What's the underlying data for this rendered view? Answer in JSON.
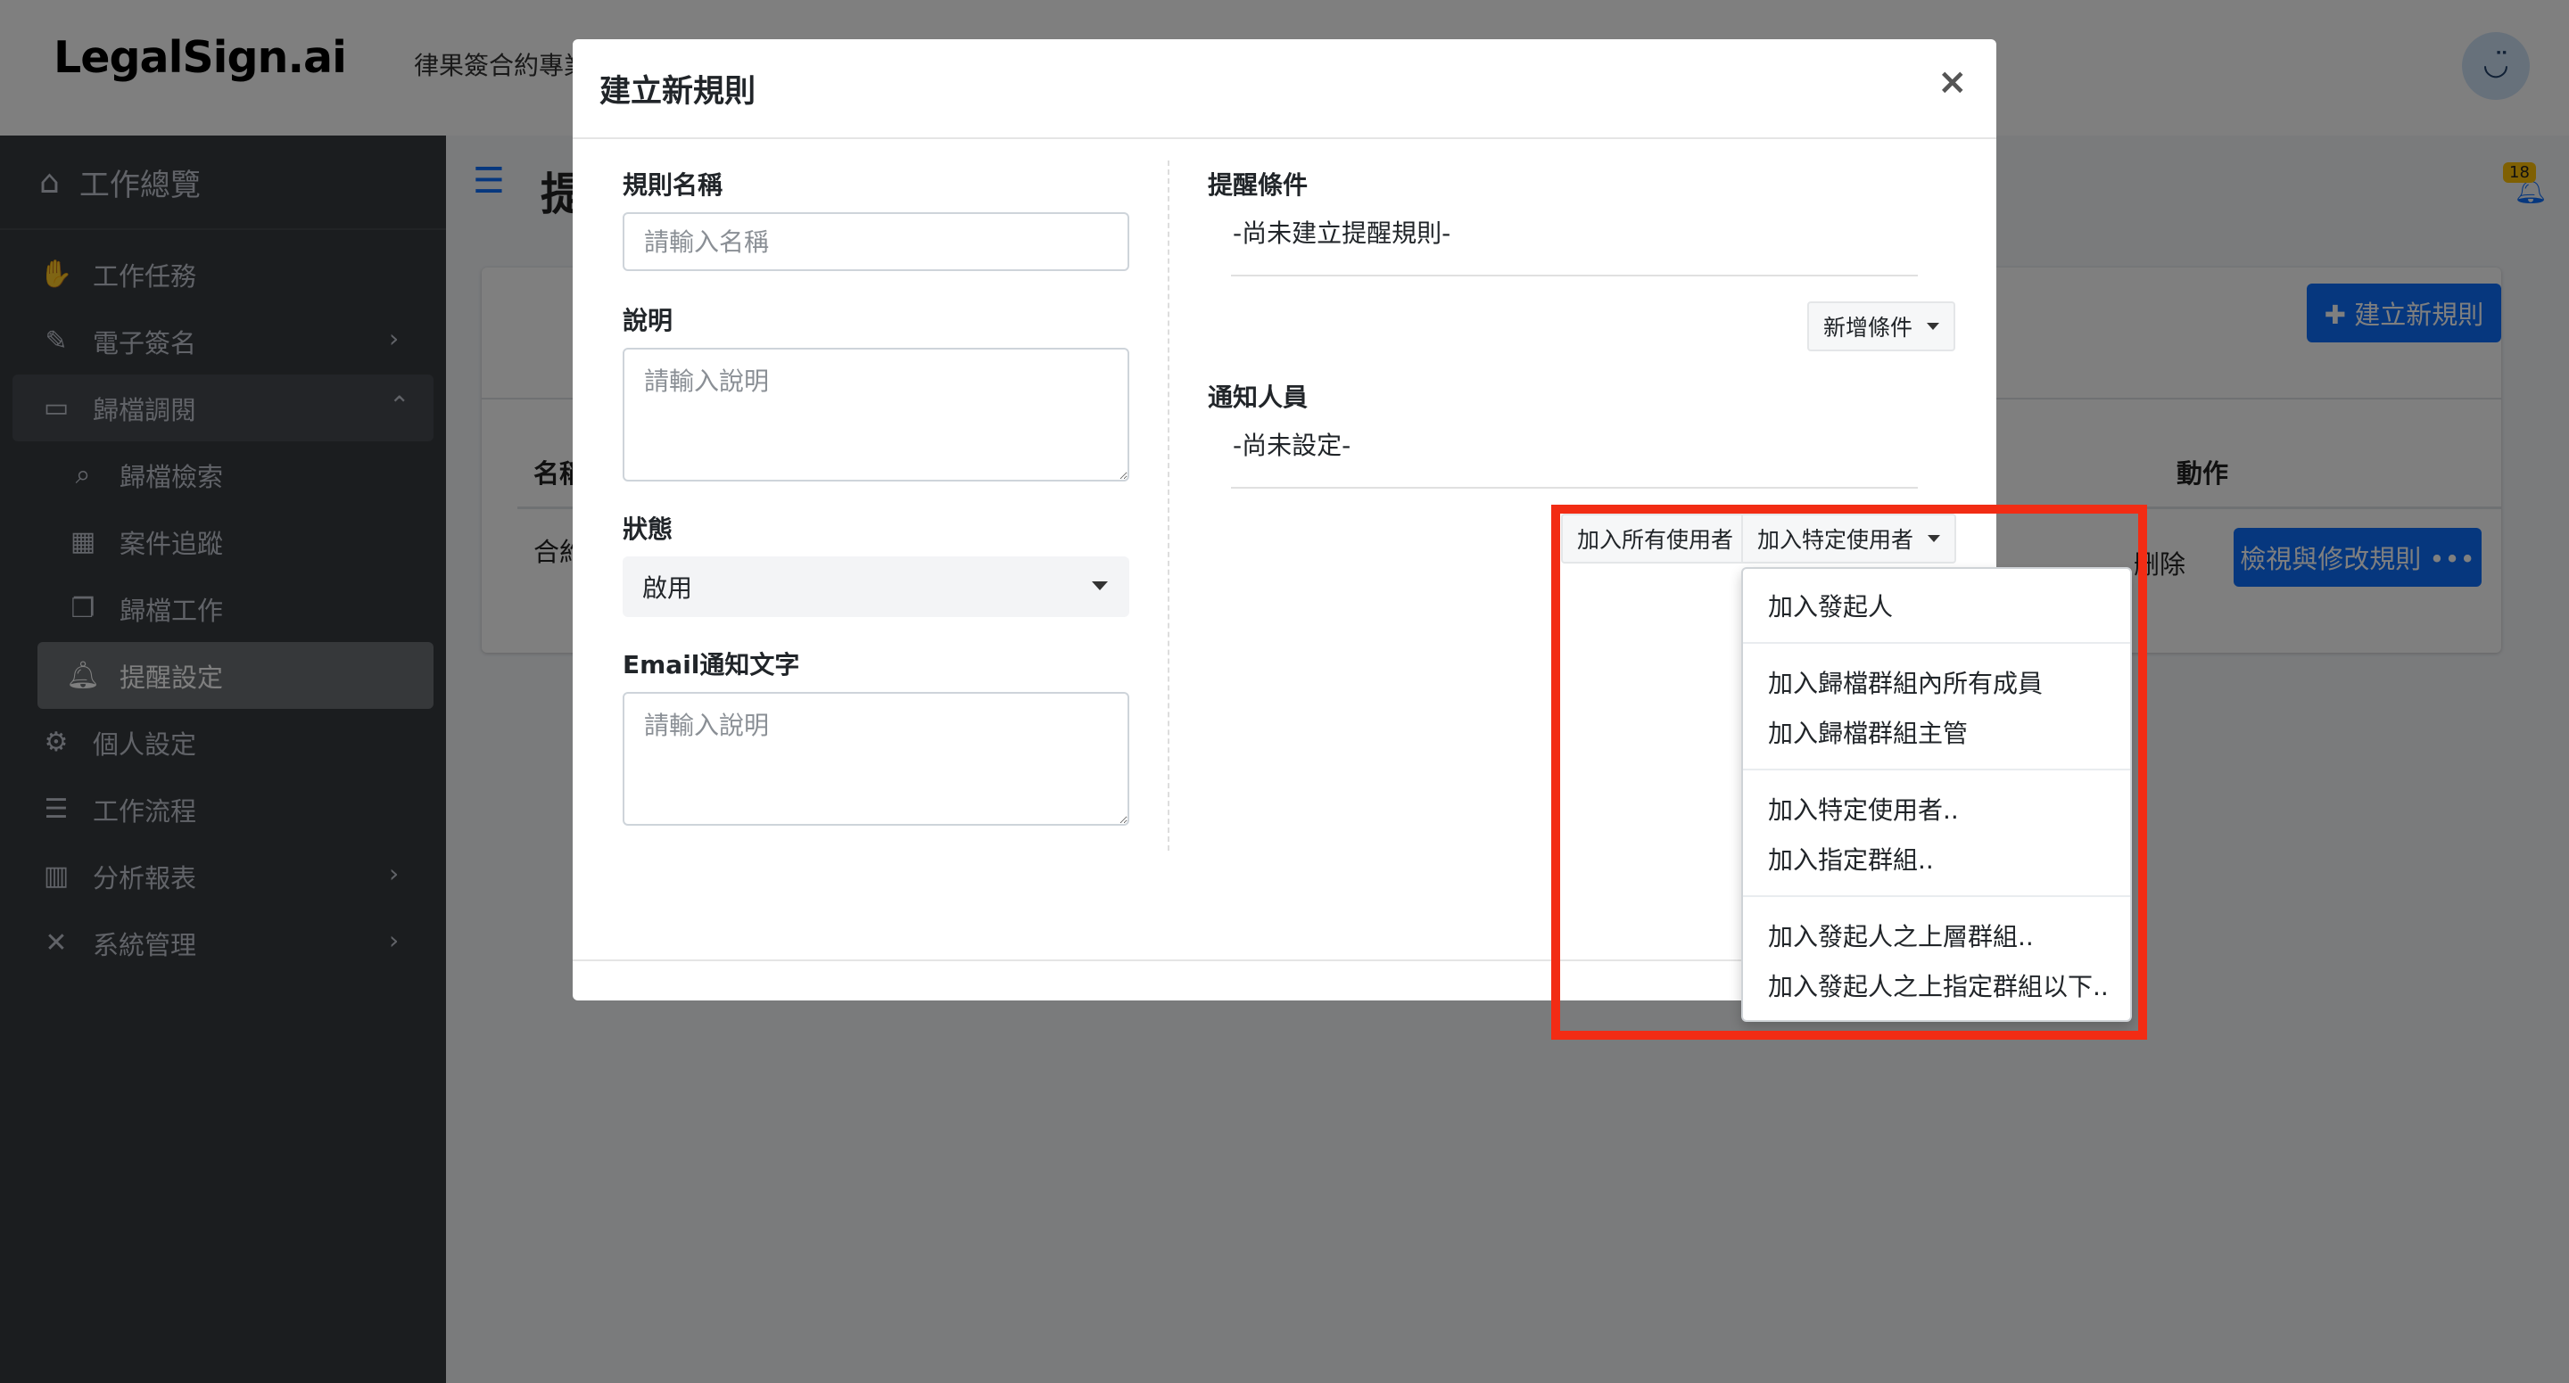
{
  "header": {
    "logo": "LegalSign.ai",
    "subtitle": "律果簽合約專業",
    "avatar": "◡̈"
  },
  "sidebar": {
    "top": {
      "label": "工作總覽",
      "icon": "home-icon"
    },
    "items": [
      {
        "label": "工作任務",
        "icon": "handshake-icon"
      },
      {
        "label": "電子簽名",
        "icon": "signature-icon",
        "chevron": "›"
      },
      {
        "label": "歸檔調閱",
        "icon": "archive-icon",
        "chevron": "⌃"
      },
      {
        "label": "歸檔檢索",
        "icon": "search-icon"
      },
      {
        "label": "案件追蹤",
        "icon": "calendar-icon"
      },
      {
        "label": "歸檔工作",
        "icon": "copy-icon"
      },
      {
        "label": "提醒設定",
        "icon": "bell-icon"
      },
      {
        "label": "個人設定",
        "icon": "user-gear-icon"
      },
      {
        "label": "工作流程",
        "icon": "list-icon"
      },
      {
        "label": "分析報表",
        "icon": "chart-icon",
        "chevron": "›"
      },
      {
        "label": "系統管理",
        "icon": "tools-icon",
        "chevron": "›"
      }
    ]
  },
  "page": {
    "title": "提",
    "notification_count": "18",
    "new_rule_button": "✚ 建立新規則",
    "table": {
      "col_name": "名稱",
      "col_action": "動作",
      "row_name": "合約",
      "delete_label": "删除",
      "view_button": "檢視與修改規則 •••"
    }
  },
  "modal": {
    "title": "建立新規則",
    "close": "×",
    "rule_name": {
      "label": "規則名稱",
      "placeholder": "請輸入名稱"
    },
    "description": {
      "label": "說明",
      "placeholder": "請輸入說明"
    },
    "status": {
      "label": "狀態",
      "value": "啟用"
    },
    "email_text": {
      "label": "Email通知文字",
      "placeholder": "請輸入說明"
    },
    "conditions": {
      "label": "提醒條件",
      "empty": "-尚未建立提醒規則-",
      "add_button": "新增條件"
    },
    "notify": {
      "label": "通知人員",
      "empty": "-尚未設定-",
      "add_all_button": "加入所有使用者",
      "add_specific_button": "加入特定使用者"
    }
  },
  "dropdown": {
    "items": [
      "加入發起人",
      "加入歸檔群組內所有成員",
      "加入歸檔群組主管",
      "加入特定使用者..",
      "加入指定群組..",
      "加入發起人之上層群組..",
      "加入發起人之上指定群組以下.."
    ]
  },
  "colors": {
    "primary": "#0d6efd",
    "sidebar": "#363a3f",
    "highlight": "#f22c14",
    "badge": "#ffc107"
  }
}
